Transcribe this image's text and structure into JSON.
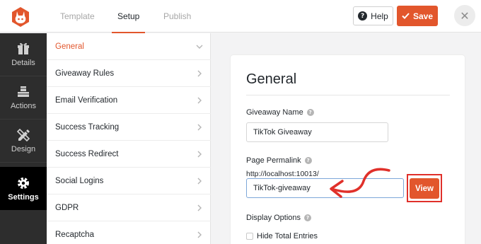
{
  "header": {
    "logo_icon": "rabbit-logo-icon",
    "tabs": [
      {
        "label": "Template",
        "active": false
      },
      {
        "label": "Setup",
        "active": true
      },
      {
        "label": "Publish",
        "active": false
      }
    ],
    "help_label": "Help",
    "save_label": "Save",
    "close_icon": "close-icon"
  },
  "sidebar": {
    "items": [
      {
        "label": "Details",
        "icon": "gift-icon",
        "active": false
      },
      {
        "label": "Actions",
        "icon": "cubes-icon",
        "active": false
      },
      {
        "label": "Design",
        "icon": "pencil-ruler-icon",
        "active": false
      },
      {
        "label": "Settings",
        "icon": "gear-icon",
        "active": true
      }
    ]
  },
  "settings_menu": {
    "items": [
      {
        "label": "General",
        "active": true
      },
      {
        "label": "Giveaway Rules",
        "active": false
      },
      {
        "label": "Email Verification",
        "active": false
      },
      {
        "label": "Success Tracking",
        "active": false
      },
      {
        "label": "Success Redirect",
        "active": false
      },
      {
        "label": "Social Logins",
        "active": false
      },
      {
        "label": "GDPR",
        "active": false
      },
      {
        "label": "Recaptcha",
        "active": false
      }
    ]
  },
  "panel": {
    "title": "General",
    "giveaway_name_label": "Giveaway Name",
    "giveaway_name_value": "TikTok Giveaway",
    "permalink_label": "Page Permalink",
    "permalink_prefix": "http://localhost:10013/",
    "permalink_value": "TikTok-giveaway",
    "view_label": "View",
    "display_options_label": "Display Options",
    "hide_total_entries_label": "Hide Total Entries",
    "hide_total_entries_checked": false
  },
  "colors": {
    "accent": "#e2562c",
    "annotation": "#e0302a",
    "sidebar_bg": "#2d2d2d"
  }
}
